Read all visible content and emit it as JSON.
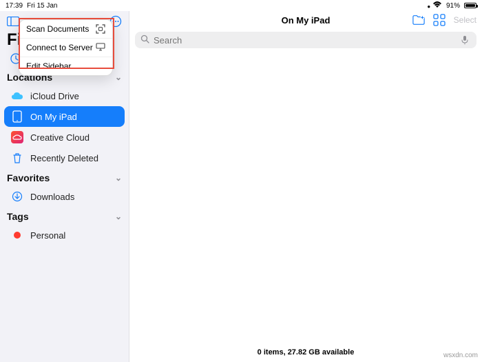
{
  "statusbar": {
    "time": "17:39",
    "date": "Fri 15 Jan",
    "battery_pct": "91%"
  },
  "sidebar": {
    "title": "Files",
    "sections": {
      "locations": {
        "label": "Locations"
      },
      "favorites": {
        "label": "Favorites"
      },
      "tags": {
        "label": "Tags"
      }
    },
    "locations": [
      {
        "label": "iCloud Drive"
      },
      {
        "label": "On My iPad"
      },
      {
        "label": "Creative Cloud"
      },
      {
        "label": "Recently Deleted"
      }
    ],
    "favorites": [
      {
        "label": "Downloads"
      }
    ],
    "tags": [
      {
        "label": "Personal"
      }
    ]
  },
  "popover": {
    "scan": "Scan Documents",
    "connect": "Connect to Server",
    "edit": "Edit Sidebar"
  },
  "main": {
    "title": "On My iPad",
    "select_label": "Select",
    "search_placeholder": "Search",
    "footer": "0 items, 27.82 GB available"
  },
  "watermark": "wsxdn.com"
}
